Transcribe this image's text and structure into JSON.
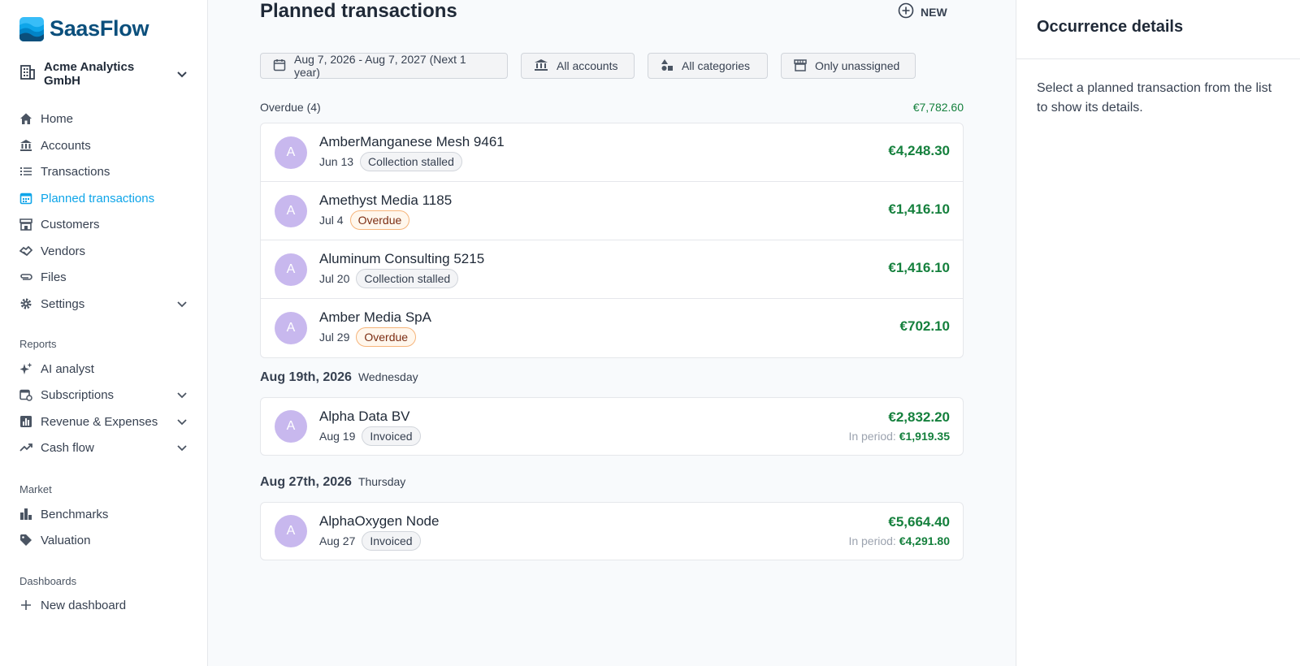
{
  "brand": {
    "name": "SaasFlow"
  },
  "org": {
    "name": "Acme Analytics GmbH"
  },
  "nav": {
    "items": [
      {
        "label": "Home",
        "icon": "home-icon"
      },
      {
        "label": "Accounts",
        "icon": "bank-icon"
      },
      {
        "label": "Transactions",
        "icon": "list-icon"
      },
      {
        "label": "Planned transactions",
        "icon": "calendar-icon",
        "active": true
      },
      {
        "label": "Customers",
        "icon": "store-icon"
      },
      {
        "label": "Vendors",
        "icon": "handshake-icon"
      },
      {
        "label": "Files",
        "icon": "paperclip-icon"
      },
      {
        "label": "Settings",
        "icon": "gear-icon"
      }
    ],
    "reports_label": "Reports",
    "reports": [
      {
        "label": "AI analyst",
        "icon": "sparkle-icon"
      },
      {
        "label": "Subscriptions",
        "icon": "calendar-refresh-icon"
      },
      {
        "label": "Revenue & Expenses",
        "icon": "bar-chart-icon"
      },
      {
        "label": "Cash flow",
        "icon": "trend-icon"
      }
    ],
    "market_label": "Market",
    "market": [
      {
        "label": "Benchmarks",
        "icon": "bar-chart-icon"
      },
      {
        "label": "Valuation",
        "icon": "tag-icon"
      }
    ],
    "dashboards_label": "Dashboards",
    "new_dashboard": "New dashboard"
  },
  "page": {
    "title": "Planned transactions",
    "new_label": "NEW"
  },
  "filters": {
    "date_range": "Aug 7, 2026 - Aug 7, 2027 (Next 1 year)",
    "accounts": "All accounts",
    "categories": "All categories",
    "assignment": "Only unassigned"
  },
  "overdue": {
    "title": "Overdue (4)",
    "total": "€7,782.60",
    "rows": [
      {
        "initial": "A",
        "name": "AmberManganese Mesh 9461",
        "date": "Jun 13",
        "status": "Collection stalled",
        "amount": "€4,248.30"
      },
      {
        "initial": "A",
        "name": "Amethyst Media 1185",
        "date": "Jul 4",
        "status": "Overdue",
        "amount": "€1,416.10"
      },
      {
        "initial": "A",
        "name": "Aluminum Consulting 5215",
        "date": "Jul 20",
        "status": "Collection stalled",
        "amount": "€1,416.10"
      },
      {
        "initial": "A",
        "name": "Amber Media SpA",
        "date": "Jul 29",
        "status": "Overdue",
        "amount": "€702.10"
      }
    ]
  },
  "groups": [
    {
      "date": "Aug 19th, 2026",
      "weekday": "Wednesday",
      "row": {
        "initial": "A",
        "name": "Alpha Data BV",
        "date": "Aug 19",
        "status": "Invoiced",
        "amount": "€2,832.20",
        "in_period_label": "In period:",
        "in_period_amount": "€1,919.35"
      }
    },
    {
      "date": "Aug 27th, 2026",
      "weekday": "Thursday",
      "row": {
        "initial": "A",
        "name": "AlphaOxygen Node",
        "date": "Aug 27",
        "status": "Invoiced",
        "amount": "€5,664.40",
        "in_period_label": "In period:",
        "in_period_amount": "€4,291.80"
      }
    }
  ],
  "panel": {
    "title": "Occurrence details",
    "empty_text": "Select a planned transaction from the list to show its details."
  },
  "colors": {
    "accent": "#0ea5e9",
    "positive": "#15803d",
    "avatar": "#c8b8ee",
    "brand": "#0b4f7c"
  }
}
